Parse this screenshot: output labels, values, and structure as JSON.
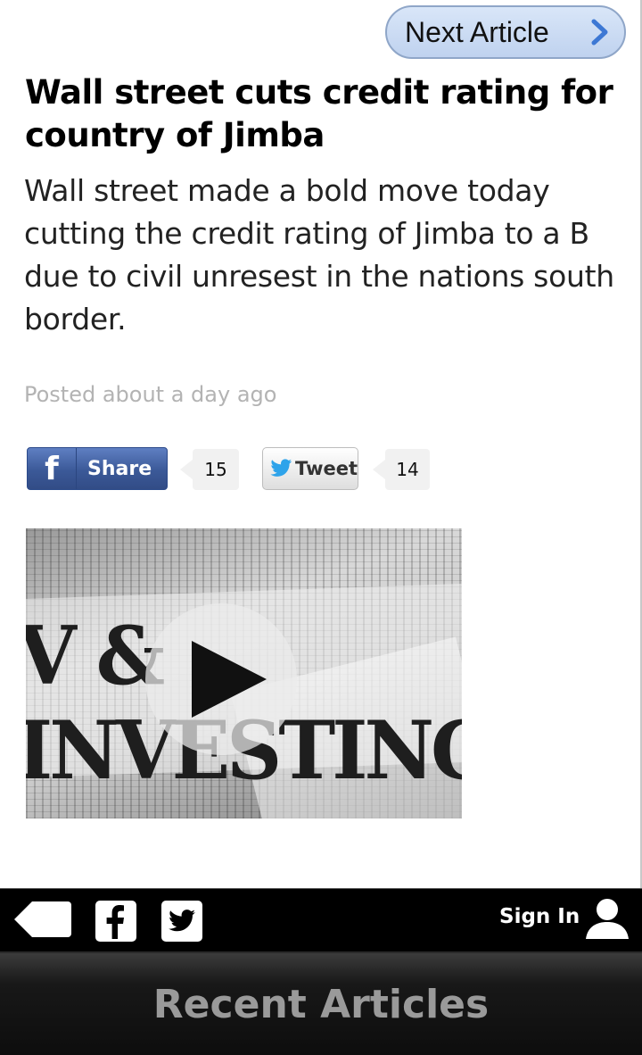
{
  "header": {
    "next_label": "Next Article"
  },
  "article": {
    "title": "Wall street cuts credit rating for country of Jimba",
    "summary": "Wall street made a bold move today cutting the credit rating of Jimba to a B due to civil unresest in the nations south border.",
    "posted": "Posted about a day ago"
  },
  "social": {
    "share_label": "Share",
    "share_count": "15",
    "tweet_label": "Tweet",
    "tweet_count": "14"
  },
  "video": {
    "headline": "V & INVESTING",
    "play_icon": "play-icon"
  },
  "bottom_bar": {
    "icons": [
      "back-icon",
      "facebook-icon",
      "twitter-icon",
      "user-icon"
    ],
    "signin_label": "Sign In"
  },
  "recent": {
    "label": "Recent Articles"
  },
  "colors": {
    "facebook_blue": "#3b5998",
    "next_button": "#c8d9f3",
    "twitter_blue": "#2ea3ea"
  }
}
